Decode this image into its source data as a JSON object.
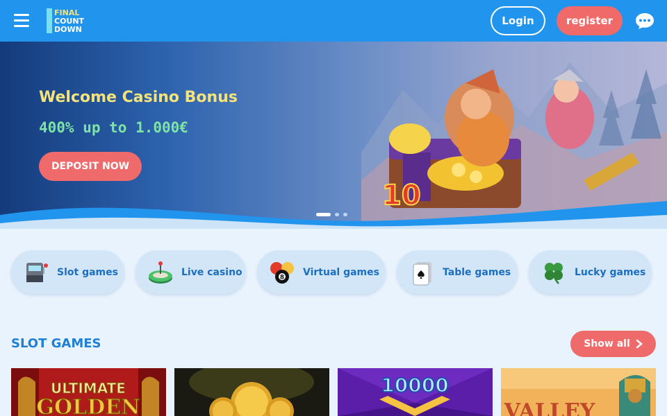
{
  "header": {
    "logo_text": [
      "FINAL",
      "COUNT",
      "DOWN"
    ],
    "login_label": "Login",
    "register_label": "register",
    "icons": {
      "menu": "hamburger-menu-icon",
      "chat": "chat-bubble-icon"
    },
    "colors": {
      "bar": "#2194ee",
      "register": "#f06a6a"
    }
  },
  "banner": {
    "title": "Welcome Casino Bonus",
    "subtitle": "400% up to 1.000€",
    "cta_label": "DEPOSIT NOW",
    "slides": {
      "count": 3,
      "active": 1
    },
    "colors": {
      "title": "#f3e37a",
      "subtitle": "#7ee3a4",
      "cta": "#ef6b6b"
    }
  },
  "categories": [
    {
      "label": "Slot games",
      "icon": "slot-machine-icon"
    },
    {
      "label": "Live casino",
      "icon": "roulette-table-icon"
    },
    {
      "label": "Virtual games",
      "icon": "billiard-ball-icon"
    },
    {
      "label": "Table games",
      "icon": "playing-card-icon"
    },
    {
      "label": "Lucky games",
      "icon": "clover-icon"
    }
  ],
  "section": {
    "title": "SLOT GAMES",
    "show_all_label": "Show all",
    "show_all_icon": "chevron-right-icon"
  },
  "game_tiles": [
    {
      "name": "Ultimate Golden",
      "title_text": [
        "ULTIMATE",
        "GOLDEN"
      ]
    },
    {
      "name": "Gold coins game",
      "title_text": []
    },
    {
      "name": "10000",
      "title_text": [
        "10000"
      ]
    },
    {
      "name": "Valley",
      "title_text": [
        "VALLEY"
      ]
    }
  ]
}
